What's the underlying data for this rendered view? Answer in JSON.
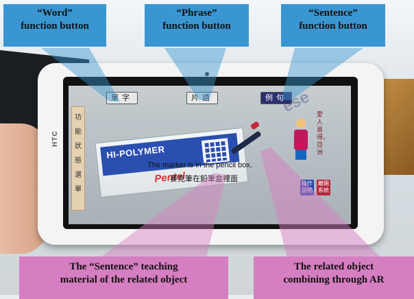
{
  "callouts": {
    "word": {
      "line1": "“Word”",
      "line2": "function button"
    },
    "phrase": {
      "line1": "“Phrase”",
      "line2": "function button"
    },
    "sentence": {
      "line1": "“Sentence”",
      "line2": "function button"
    },
    "teaching_material": {
      "line1": "The “Sentence” teaching",
      "line2": "material of the related object"
    },
    "ar_object": {
      "line1": "The related object",
      "line2": "combining through AR"
    }
  },
  "tablet": {
    "brand": "HTC",
    "app": {
      "buttons": {
        "word": "單字",
        "phrase": "片語",
        "sentence": "例句"
      },
      "active_button": "sentence",
      "left_strip_chars": [
        "功",
        "能",
        "狀",
        "態",
        "選",
        "單"
      ],
      "sentence_en": "The marker is in the pencil box.",
      "sentence_zh": "麥克筆在鉛筆盒裡面",
      "eraser_brand": "HI-POLYMER",
      "eraser_logo": "Pentel",
      "side_buttons": {
        "operation": "操作說明",
        "leave": "離開系統"
      },
      "vertical_caption": "愛人易得，亞洲"
    }
  },
  "colors": {
    "callout_blue": "#3a96d1",
    "callout_pink": "#d67ec2",
    "active_button": "#2b2f6e"
  }
}
